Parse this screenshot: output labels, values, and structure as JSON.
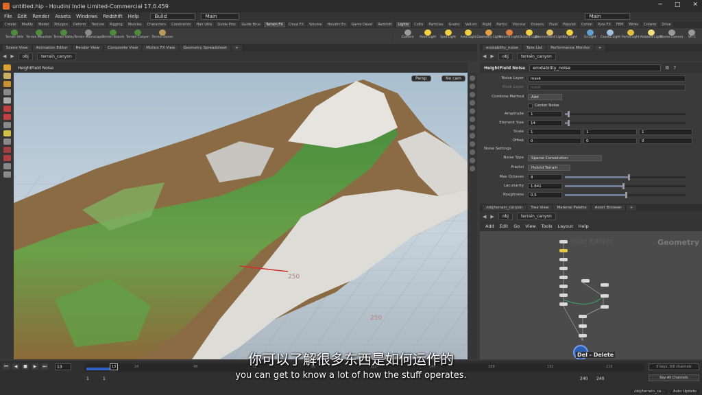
{
  "window": {
    "title": "untitled.hip - Houdini Indie Limited-Commercial 17.0.459"
  },
  "menubar": {
    "items": [
      "File",
      "Edit",
      "Render",
      "Assets",
      "Windows",
      "Redshift",
      "Help"
    ],
    "desktop": "Build",
    "main": "Main"
  },
  "shelf_left": {
    "tabs": [
      "Create",
      "Modify",
      "Model",
      "Polygon",
      "Deform",
      "Texture",
      "Rigging",
      "Muscles",
      "Characters",
      "Constraints",
      "Hair Utils",
      "Guide Proc",
      "Guide Brus",
      "Terrain FX",
      "Cloud FX",
      "Volume",
      "Houdini En",
      "Game Devel",
      "Redshift"
    ],
    "tools": [
      "Terrain Hills",
      "Terrain Mountain",
      "Terrain Valley",
      "Terrain Moonscape",
      "Terrain Islands",
      "Terrain Canyon",
      "Terrain Dunes"
    ]
  },
  "shelf_right": {
    "tabs": [
      "Lights",
      "Collis",
      "Particles",
      "Grains",
      "Vellum",
      "Rigid",
      "Particl",
      "Viscous",
      "Oceans",
      "Fluid",
      "Populat",
      "Contai",
      "Pyro FX",
      "FEM",
      "Wires",
      "Crowds",
      "Drive"
    ],
    "tools": [
      "Camera",
      "Point Light",
      "Spot Light",
      "Area Light",
      "Geometry Light",
      "Volume Light",
      "Distant Light",
      "Environment Light",
      "Sky Light",
      "GI Light",
      "Caustic Light",
      "Portal Light",
      "Ambient Light",
      "Stereo Camera",
      "VR C"
    ],
    "main": "Main"
  },
  "viewport_tabs": [
    "Scene View",
    "Animation Editor",
    "Render View",
    "Composite View",
    "Motion FX View",
    "Geometry Spreadsheet"
  ],
  "viewport_path": {
    "obj": "obj",
    "node": "terrain_canyon"
  },
  "viewport": {
    "node_type": "HeightField Noise",
    "persp": "Persp",
    "cam": "No cam",
    "grid_labels": [
      "250",
      "250"
    ]
  },
  "param_tabs": [
    "erodability_noise",
    "Take List",
    "Performance Monitor"
  ],
  "param_path": {
    "obj": "obj",
    "node": "terrain_canyon"
  },
  "param_header": {
    "type": "HeightField Noise",
    "name": "erodability_noise"
  },
  "params": {
    "noise_layer_label": "Noise Layer",
    "noise_layer": "mask",
    "mask_layer_label": "Mask Layer",
    "mask_layer": "mask",
    "combine_label": "Combine Method",
    "combine": "Add",
    "center_noise": "Center Noise",
    "amplitude_label": "Amplitude",
    "amplitude": "1",
    "amplitude_frac": 0.02,
    "element_size_label": "Element Size",
    "element_size": "14",
    "element_size_frac": 0.02,
    "scale_label": "Scale",
    "scale": [
      "1",
      "1",
      "1"
    ],
    "offset_label": "Offset",
    "offset": [
      "0",
      "0",
      "0"
    ],
    "noise_settings": "Noise Settings",
    "noise_type_label": "Noise Type",
    "noise_type": "Sparse Convolution",
    "fractal_label": "Fractal",
    "fractal": "Hybrid Terrain",
    "max_octaves_label": "Max Octaves",
    "max_octaves": "8",
    "max_octaves_frac": 0.52,
    "lacunarity_label": "Lacunarity",
    "lacunarity": "1.841",
    "lacunarity_frac": 0.48,
    "roughness_label": "Roughness",
    "roughness": "0.5",
    "roughness_frac": 0.5
  },
  "network_tabs": [
    "/obj/terrain_canyon",
    "Tree View",
    "Material Palette",
    "Asset Browser"
  ],
  "network_path": {
    "obj": "obj",
    "node": "terrain_canyon"
  },
  "network_menu": [
    "Add",
    "Edit",
    "Go",
    "View",
    "Tools",
    "Layout",
    "Help"
  ],
  "network": {
    "watermark": "Geometry",
    "edition": "Indie Edition",
    "delete_hint": "Del - Delete"
  },
  "timeline": {
    "frame": "13",
    "current": "13",
    "ticks": [
      "24",
      "48",
      "72",
      "96",
      "120",
      "144",
      "168",
      "192",
      "216"
    ],
    "start": "1",
    "start2": "1",
    "end": "240",
    "end2": "240",
    "keys": "0 keys, 0/0 channels",
    "key_all": "Key All Channels"
  },
  "status": {
    "path": "/obj/terrain_ca...",
    "update": "Auto Update"
  },
  "subtitles": {
    "zh": "你可以了解很多东西是如何运作的",
    "en": "you can get to know a lot of how the stuff operates."
  }
}
